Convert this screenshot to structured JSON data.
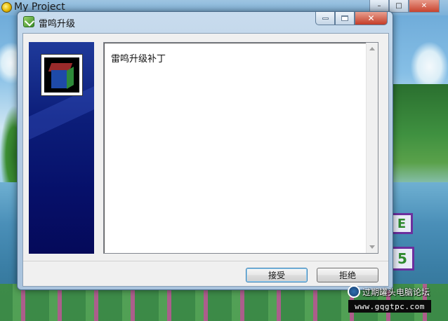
{
  "parent_window": {
    "title": "My Project",
    "controls": {
      "minimize": "–",
      "maximize": "□",
      "close": "✕"
    }
  },
  "dialog": {
    "title": "雷鸣升级",
    "controls": {
      "close": "✕"
    },
    "license_text": "雷鸣升级补丁",
    "buttons": {
      "accept": "接受",
      "reject": "拒绝"
    }
  },
  "background": {
    "panel_e": "E",
    "panel_5": "5"
  },
  "watermark": {
    "line1": "过期罐头电脑论坛",
    "line2": "www.gqgtpc.com"
  },
  "colors": {
    "banner_blue": "#0c1e7a",
    "accent_border": "#3c7fb1",
    "close_red": "#c43c27"
  },
  "icons": [
    "app-logo-icon",
    "dialog-app-icon",
    "minimize-icon",
    "maximize-icon",
    "close-icon",
    "product-cube-icon",
    "scroll-up-icon",
    "scroll-down-icon"
  ]
}
